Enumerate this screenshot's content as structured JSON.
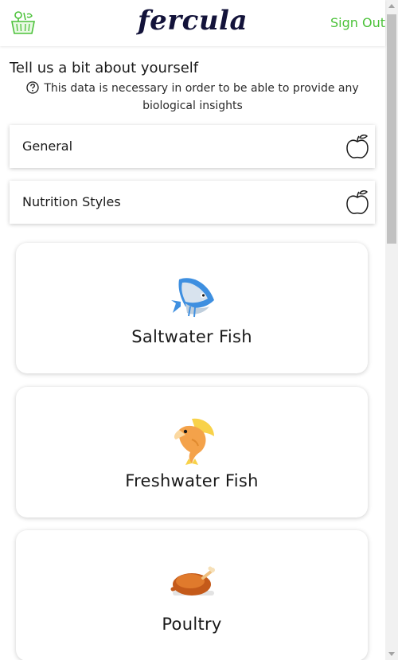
{
  "header": {
    "brand": "fercula",
    "sign_out_label": "Sign Out",
    "logo_icon": "basket-icon"
  },
  "intro": {
    "title": "Tell us a bit about yourself",
    "note": "This data is necessary in order to be able to provide any biological insights",
    "note_icon": "question-circle-icon"
  },
  "sections": [
    {
      "label": "General",
      "icon": "apple-icon"
    },
    {
      "label": "Nutrition Styles",
      "icon": "apple-icon"
    }
  ],
  "foods": [
    {
      "label": "Saltwater Fish",
      "icon": "saltwater-fish-icon"
    },
    {
      "label": "Freshwater Fish",
      "icon": "freshwater-fish-icon"
    },
    {
      "label": "Poultry",
      "icon": "roast-chicken-icon"
    }
  ],
  "colors": {
    "accent": "#4cc23a",
    "brand": "#13133a"
  }
}
